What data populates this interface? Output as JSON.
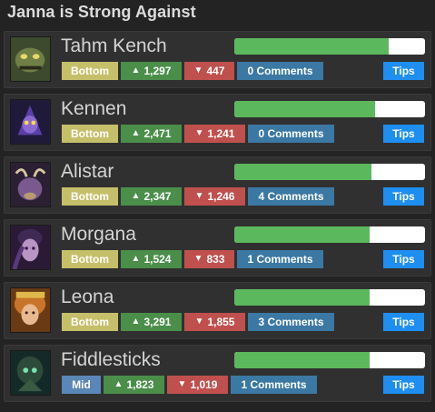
{
  "page": {
    "title": "Janna is Strong Against"
  },
  "colors": {
    "bar_fill": "#5cb85c",
    "bar_bg": "#ffffff",
    "tips": "#1e8ef0"
  },
  "icons": {
    "upvote": "chevron-up-icon",
    "downvote": "chevron-down-icon"
  },
  "counters": [
    {
      "name": "Tahm Kench",
      "lane": "Bottom",
      "upvotes": "1,297",
      "downvotes": "447",
      "comments": "0 Comments",
      "tips": "Tips",
      "bar_fraction": 0.81
    },
    {
      "name": "Kennen",
      "lane": "Bottom",
      "upvotes": "2,471",
      "downvotes": "1,241",
      "comments": "0 Comments",
      "tips": "Tips",
      "bar_fraction": 0.74
    },
    {
      "name": "Alistar",
      "lane": "Bottom",
      "upvotes": "2,347",
      "downvotes": "1,246",
      "comments": "4 Comments",
      "tips": "Tips",
      "bar_fraction": 0.72
    },
    {
      "name": "Morgana",
      "lane": "Bottom",
      "upvotes": "1,524",
      "downvotes": "833",
      "comments": "1 Comments",
      "tips": "Tips",
      "bar_fraction": 0.71
    },
    {
      "name": "Leona",
      "lane": "Bottom",
      "upvotes": "3,291",
      "downvotes": "1,855",
      "comments": "3 Comments",
      "tips": "Tips",
      "bar_fraction": 0.71
    },
    {
      "name": "Fiddlesticks",
      "lane": "Mid",
      "upvotes": "1,823",
      "downvotes": "1,019",
      "comments": "1 Comments",
      "tips": "Tips",
      "bar_fraction": 0.71
    }
  ]
}
